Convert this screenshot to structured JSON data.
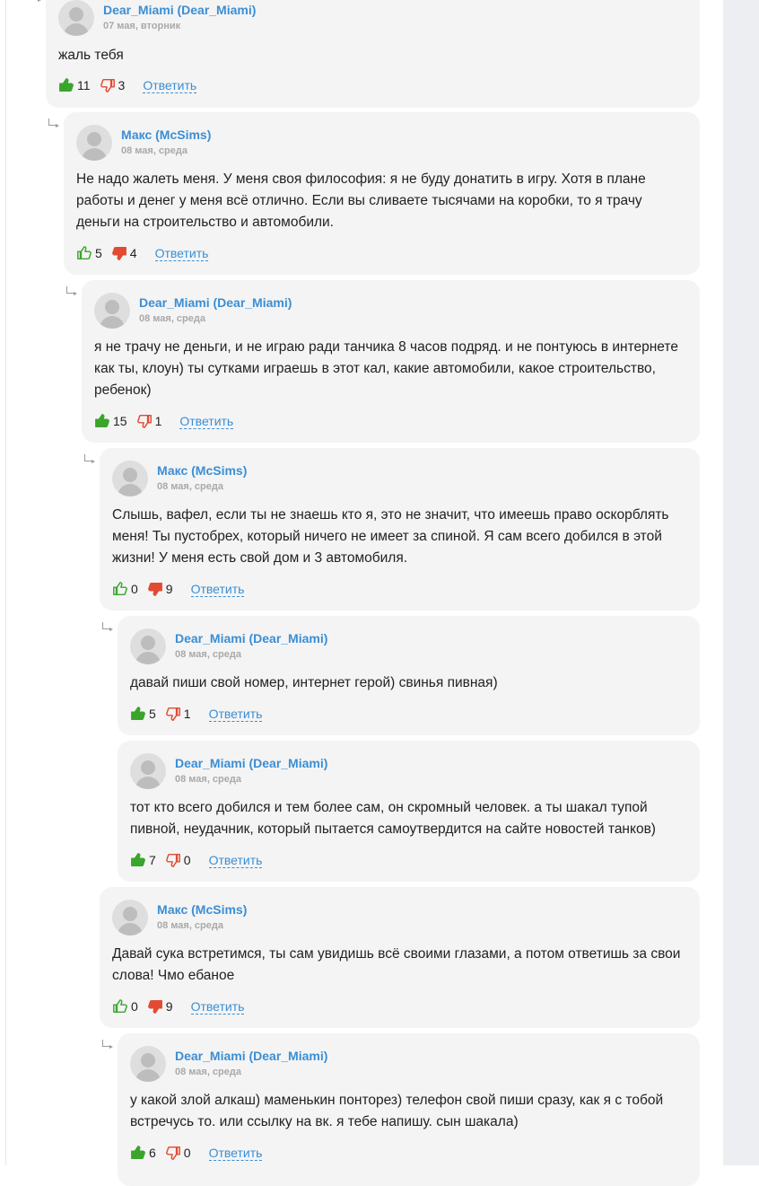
{
  "reply_label": "Ответить",
  "comments": [
    {
      "author": "Dear_Miami (Dear_Miami)",
      "date": "07 мая, вторник",
      "text": "жаль тебя",
      "likes": "11",
      "dislikes": "3",
      "like_active": true,
      "dislike_active": false
    },
    {
      "author": "Макс (McSims)",
      "date": "08 мая, среда",
      "text": "Не надо жалеть меня. У меня своя философия: я не буду донатить в игру. Хотя в плане работы и денег у меня всё отлично. Если вы сливаете тысячами на коробки, то я трачу деньги на строительство и автомобили.",
      "likes": "5",
      "dislikes": "4",
      "like_active": false,
      "dislike_active": true
    },
    {
      "author": "Dear_Miami (Dear_Miami)",
      "date": "08 мая, среда",
      "text": "я не трачу не деньги, и не играю ради танчика 8 часов подряд. и не понтуюсь в интернете как ты, клоун) ты сутками играешь в этот кал, какие автомобили, какое строительство, ребенок)",
      "likes": "15",
      "dislikes": "1",
      "like_active": true,
      "dislike_active": false
    },
    {
      "author": "Макс (McSims)",
      "date": "08 мая, среда",
      "text": "Слышь, вафел, если ты не знаешь кто я, это не значит, что имеешь право оскорблять меня! Ты пустобрех, который ничего не имеет за спиной. Я сам всего добился в этой жизни! У меня есть свой дом и 3 автомобиля.",
      "likes": "0",
      "dislikes": "9",
      "like_active": false,
      "dislike_active": true
    },
    {
      "author": "Dear_Miami (Dear_Miami)",
      "date": "08 мая, среда",
      "text": "давай пиши свой номер, интернет герой) свинья пивная)",
      "likes": "5",
      "dislikes": "1",
      "like_active": true,
      "dislike_active": false
    },
    {
      "author": "Dear_Miami (Dear_Miami)",
      "date": "08 мая, среда",
      "text": "тот кто всего добился и тем более сам, он скромный человек. а ты шакал тупой пивной, неудачник, который пытается самоутвердится на сайте новостей танков)",
      "likes": "7",
      "dislikes": "0",
      "like_active": true,
      "dislike_active": false
    },
    {
      "author": "Макс (McSims)",
      "date": "08 мая, среда",
      "text": "Давай сука встретимся, ты сам увидишь всё своими глазами, а потом ответишь за свои слова! Чмо ебаное",
      "likes": "0",
      "dislikes": "9",
      "like_active": false,
      "dislike_active": true
    },
    {
      "author": "Dear_Miami (Dear_Miami)",
      "date": "08 мая, среда",
      "text": "у какой злой алкаш) маменькин понторез) телефон свой пиши сразу, как я с тобой встречусь то. или ссылку на вк. я тебе напишу. сын шакала)",
      "likes": "6",
      "dislikes": "0",
      "like_active": true,
      "dislike_active": false
    }
  ]
}
